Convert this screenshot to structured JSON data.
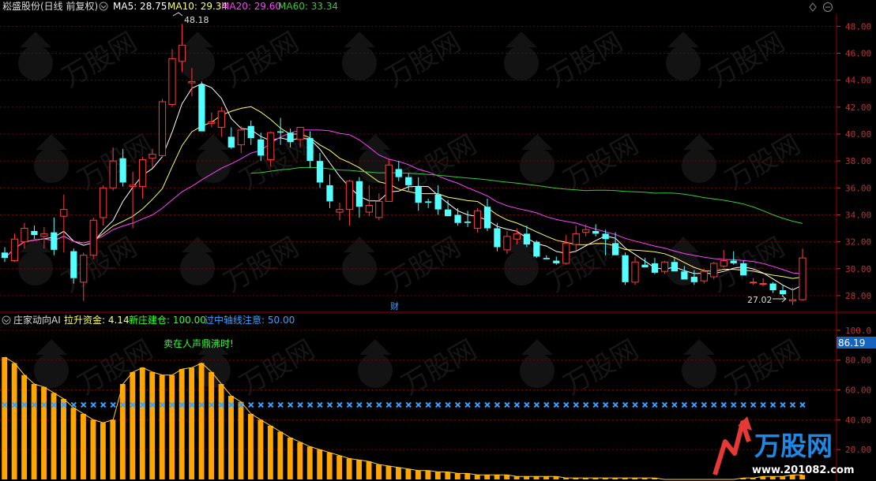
{
  "colors": {
    "up": "#ff3b3b",
    "down": "#54ffff",
    "ma5": "#ffffff",
    "ma10": "#ffff66",
    "ma20": "#ff40ff",
    "ma60": "#33cc33",
    "grid": "#7a0000",
    "axis_text": "#c03030",
    "orange": "#ffa500",
    "green_bar": "#33ff33",
    "cross": "#3aa0ff",
    "highlight_box": "#1565c0"
  },
  "header": {
    "stock_name": "崧盛股份(日线 前复权)",
    "ma5_label": "MA5: 28.75",
    "ma10_label": "MA10: 29.34",
    "ma20_label": "MA20: 29.60",
    "ma60_label": "MA60: 33.34"
  },
  "indicator_header": {
    "name": "庄家动向AI",
    "lift_funds": "拉升资金: 4.14",
    "new_position": "新庄建仓: 100.00",
    "mid_axis": "过中轴线注意: 50.00"
  },
  "annotations": {
    "high_label": "48.18",
    "low_label": "27.02",
    "cai_label": "财",
    "sell_label": "卖在人声鼎沸时!",
    "current_value": "86.19"
  },
  "watermark": {
    "brand": "万股网",
    "site": "www.201082.com"
  },
  "chart_data": [
    {
      "type": "candlestick",
      "y_ticks": [
        "48.00",
        "46.00",
        "44.00",
        "42.00",
        "40.00",
        "38.00",
        "36.00",
        "34.00",
        "32.00",
        "30.00",
        "28.00"
      ],
      "ylim": [
        27.0,
        48.9
      ],
      "candles": [
        [
          31.2,
          31.6,
          30.5,
          30.8
        ],
        [
          30.6,
          32.6,
          30.5,
          32.2
        ],
        [
          32.0,
          33.4,
          31.5,
          33.0
        ],
        [
          32.8,
          33.2,
          32.2,
          32.5
        ],
        [
          32.4,
          33.1,
          31.5,
          32.6
        ],
        [
          32.7,
          33.8,
          31.0,
          31.4
        ],
        [
          33.9,
          35.5,
          31.2,
          34.4
        ],
        [
          31.3,
          31.5,
          28.9,
          29.3
        ],
        [
          29.0,
          31.2,
          27.6,
          31.0
        ],
        [
          31.0,
          33.8,
          30.7,
          33.6
        ],
        [
          33.8,
          36.2,
          33.2,
          36.0
        ],
        [
          36.0,
          39.0,
          35.8,
          38.0
        ],
        [
          38.2,
          38.9,
          36.1,
          36.4
        ],
        [
          36.1,
          37.2,
          33.0,
          36.2
        ],
        [
          36.1,
          38.3,
          35.2,
          38.1
        ],
        [
          38.2,
          38.9,
          37.5,
          38.5
        ],
        [
          38.4,
          42.6,
          38.3,
          42.4
        ],
        [
          42.2,
          46.3,
          42.0,
          45.6
        ],
        [
          45.4,
          48.18,
          44.6,
          46.6
        ],
        [
          43.8,
          44.9,
          42.8,
          43.9
        ],
        [
          43.7,
          43.9,
          40.5,
          40.2
        ],
        [
          40.8,
          41.6,
          40.5,
          40.9
        ],
        [
          40.5,
          42.0,
          39.8,
          41.7
        ],
        [
          39.8,
          40.5,
          38.9,
          39.0
        ],
        [
          39.2,
          40.6,
          38.6,
          40.3
        ],
        [
          40.6,
          41.0,
          39.2,
          39.7
        ],
        [
          39.6,
          40.1,
          38.0,
          38.4
        ],
        [
          38.1,
          40.2,
          37.6,
          40.1
        ],
        [
          40.2,
          41.2,
          39.2,
          40.1
        ],
        [
          40.1,
          40.4,
          39.0,
          39.4
        ],
        [
          39.6,
          40.5,
          39.0,
          40.5
        ],
        [
          39.7,
          40.2,
          37.5,
          38.0
        ],
        [
          38.0,
          38.6,
          36.0,
          36.4
        ],
        [
          36.2,
          37.0,
          34.5,
          35.0
        ],
        [
          34.2,
          34.9,
          33.6,
          34.4
        ],
        [
          34.4,
          36.6,
          33.2,
          36.5
        ],
        [
          36.5,
          36.8,
          33.8,
          34.6
        ],
        [
          34.2,
          36.2,
          33.9,
          34.7
        ],
        [
          33.8,
          35.6,
          33.6,
          35.0
        ],
        [
          35.0,
          38.1,
          35.0,
          37.7
        ],
        [
          37.4,
          38.0,
          36.5,
          36.8
        ],
        [
          36.8,
          37.1,
          35.8,
          36.2
        ],
        [
          36.1,
          36.8,
          34.3,
          34.9
        ],
        [
          35.0,
          35.2,
          34.5,
          34.9
        ],
        [
          35.5,
          36.2,
          34.0,
          34.4
        ],
        [
          34.4,
          35.1,
          34.0,
          33.9
        ],
        [
          34.0,
          34.5,
          33.2,
          33.4
        ],
        [
          33.5,
          34.3,
          33.1,
          33.4
        ],
        [
          33.0,
          34.5,
          32.7,
          34.3
        ],
        [
          34.6,
          35.2,
          32.8,
          33.0
        ],
        [
          33.0,
          33.4,
          31.3,
          31.6
        ],
        [
          31.4,
          32.8,
          31.1,
          32.4
        ],
        [
          32.2,
          33.0,
          31.8,
          32.6
        ],
        [
          32.6,
          33.2,
          31.6,
          31.8
        ],
        [
          32.0,
          32.1,
          30.8,
          30.9
        ],
        [
          30.8,
          31.0,
          30.7,
          30.7
        ],
        [
          30.6,
          30.9,
          30.3,
          30.4
        ],
        [
          30.4,
          32.5,
          30.3,
          31.9
        ],
        [
          31.8,
          33.2,
          31.2,
          32.6
        ],
        [
          32.7,
          33.3,
          32.4,
          32.9
        ],
        [
          32.8,
          33.3,
          32.4,
          32.6
        ],
        [
          32.6,
          32.9,
          31.0,
          32.2
        ],
        [
          31.9,
          32.7,
          31.0,
          31.0
        ],
        [
          31.0,
          31.2,
          28.8,
          29.0
        ],
        [
          29.0,
          30.9,
          28.8,
          30.5
        ],
        [
          30.3,
          30.8,
          30.1,
          30.1
        ],
        [
          30.4,
          30.8,
          29.6,
          29.7
        ],
        [
          29.8,
          30.6,
          29.6,
          30.5
        ],
        [
          30.5,
          30.8,
          29.8,
          29.8
        ],
        [
          29.8,
          30.2,
          29.2,
          29.2
        ],
        [
          29.4,
          29.9,
          28.8,
          29.0
        ],
        [
          29.1,
          30.0,
          28.9,
          29.8
        ],
        [
          29.4,
          30.5,
          29.2,
          30.4
        ],
        [
          30.2,
          31.4,
          30.1,
          30.6
        ],
        [
          30.6,
          31.3,
          30.3,
          30.4
        ],
        [
          30.4,
          30.6,
          29.5,
          29.5
        ],
        [
          29.0,
          29.3,
          28.8,
          29.0
        ],
        [
          28.9,
          29.3,
          28.7,
          28.9
        ],
        [
          28.9,
          29.0,
          28.2,
          28.4
        ],
        [
          28.4,
          28.8,
          28.0,
          28.1
        ],
        [
          27.6,
          28.6,
          27.3,
          27.7
        ],
        [
          27.7,
          31.5,
          27.6,
          30.8
        ]
      ]
    },
    {
      "type": "bar",
      "y_ticks": [
        "100.0",
        "80.00",
        "60.00",
        "40.00",
        "20.00"
      ],
      "ylim": [
        0,
        110
      ],
      "mid_axis": 50,
      "orange_values": [
        82,
        78,
        70,
        64,
        62,
        58,
        54,
        48,
        44,
        40,
        38,
        40,
        64,
        72,
        75,
        72,
        70,
        70,
        74,
        75,
        78,
        72,
        64,
        56,
        52,
        44,
        40,
        36,
        32,
        28,
        25,
        22,
        20,
        18,
        16,
        14,
        13,
        12,
        10,
        9,
        8,
        7,
        6,
        6,
        5,
        5,
        4,
        4,
        3,
        3,
        3,
        3,
        2,
        2,
        2,
        2,
        2,
        1,
        1,
        1,
        1,
        1,
        1,
        1,
        1,
        1,
        1,
        0,
        0,
        0,
        0,
        0,
        0,
        0,
        0,
        1,
        1,
        2,
        2,
        2,
        3,
        3
      ],
      "green_values": [
        0,
        0,
        0,
        0,
        0,
        0,
        0,
        0,
        0,
        0,
        0,
        0,
        0,
        0,
        0,
        0,
        0,
        0,
        0,
        0,
        0,
        0,
        0,
        0,
        0,
        0,
        0,
        0,
        0,
        0,
        0,
        0,
        0,
        0,
        0,
        0,
        0,
        0,
        0,
        0,
        0,
        0,
        0,
        0,
        0,
        0,
        0,
        0,
        0,
        0,
        0,
        0,
        0,
        0,
        0,
        0,
        0,
        0,
        0,
        0,
        0,
        0,
        0,
        0,
        0,
        0,
        0,
        0,
        0,
        0,
        0,
        0,
        0,
        0,
        0,
        0,
        0,
        0,
        0,
        0,
        0,
        0
      ]
    }
  ]
}
